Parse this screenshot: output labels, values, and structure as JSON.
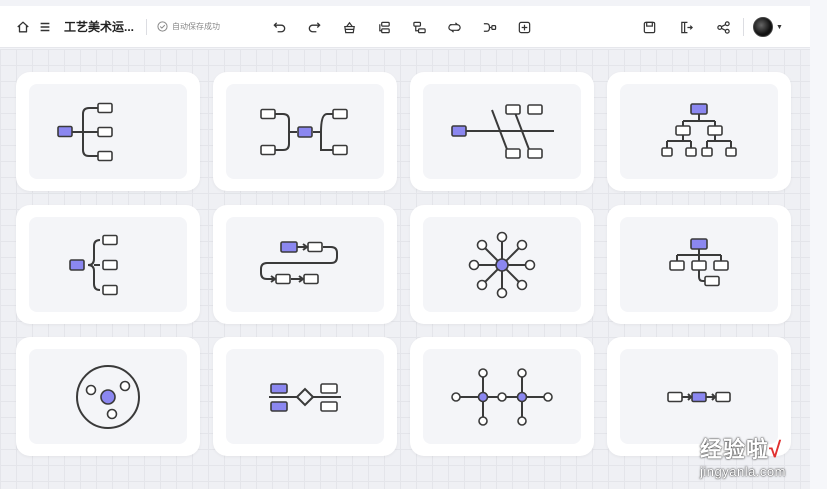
{
  "toolbar": {
    "home_icon": "home-icon",
    "menu_icon": "menu-icon",
    "title": "工艺美术运...",
    "save_status": "自动保存成功",
    "actions": [
      "undo-icon",
      "redo-icon",
      "style-icon",
      "insert-child-icon",
      "insert-sibling-icon",
      "relationship-icon",
      "summary-icon",
      "add-icon"
    ],
    "right_actions": [
      "save-icon",
      "export-icon",
      "share-icon"
    ]
  },
  "templates": [
    {
      "id": "mindmap-right"
    },
    {
      "id": "mindmap-both-sides"
    },
    {
      "id": "fishbone"
    },
    {
      "id": "org-chart"
    },
    {
      "id": "bracket-right"
    },
    {
      "id": "timeline-snake"
    },
    {
      "id": "radial-bubble"
    },
    {
      "id": "tree-down"
    },
    {
      "id": "circle-bubble"
    },
    {
      "id": "compare-bridge"
    },
    {
      "id": "horizontal-timeline"
    },
    {
      "id": "flow-chain"
    }
  ],
  "watermark": {
    "main": "经验啦",
    "check": "√",
    "url": "jingyanla.com"
  },
  "colors": {
    "accent": "#8b87f0",
    "stroke": "#3a3a3a",
    "card_bg": "#ffffff",
    "card_inner_bg": "#f4f5f8"
  }
}
